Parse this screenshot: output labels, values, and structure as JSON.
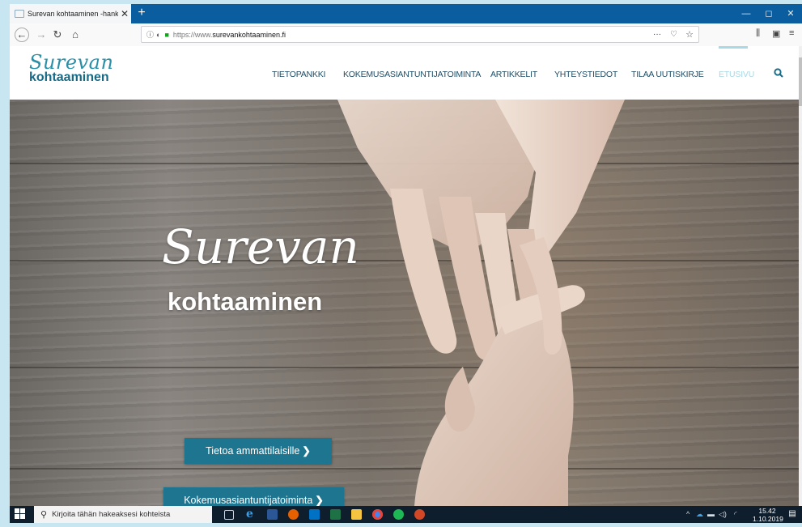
{
  "browser": {
    "tab_title": "Surevan kohtaaminen -hanke: t",
    "tab_close": "✕",
    "new_tab": "+",
    "url_prefix": "https://www.",
    "url_domain": "surevankohtaaminen.fi",
    "page_actions": "···",
    "window_controls": {
      "minimize": "—",
      "restore": "◻",
      "close": "✕"
    }
  },
  "site": {
    "logo_script": "Surevan",
    "logo_word": "kohtaaminen",
    "nav": [
      {
        "label": "TIETOPANKKI",
        "active": false
      },
      {
        "label": "KOKEMUSASIANTUNTIJATOIMINTA",
        "active": false
      },
      {
        "label": "ARTIKKELIT",
        "active": false
      },
      {
        "label": "YHTEYSTIEDOT",
        "active": false
      },
      {
        "label": "TILAA UUTISKIRJE",
        "active": false
      },
      {
        "label": "ETUSIVU",
        "active": true
      }
    ],
    "search_icon": "search-icon",
    "accent_color": "#1d7590",
    "active_color": "#a8d9e6"
  },
  "hero": {
    "script_title": "Surevan",
    "word_title": "kohtaaminen",
    "buttons": [
      {
        "label": "Tietoa ammattilaisille",
        "chevron": "❯"
      },
      {
        "label": "Kokemusasiantuntijatoiminta",
        "chevron": "❯"
      }
    ]
  },
  "taskbar": {
    "search_placeholder": "Kirjoita tähän hakeaksesi kohteista",
    "time": "15.42",
    "date": "1.10.2019",
    "apps": [
      "task-view-icon",
      "edge-icon",
      "word-icon",
      "firefox-icon",
      "outlook-icon",
      "excel-icon",
      "file-explorer-icon",
      "chrome-icon",
      "spotify-icon",
      "powerpoint-icon"
    ]
  }
}
